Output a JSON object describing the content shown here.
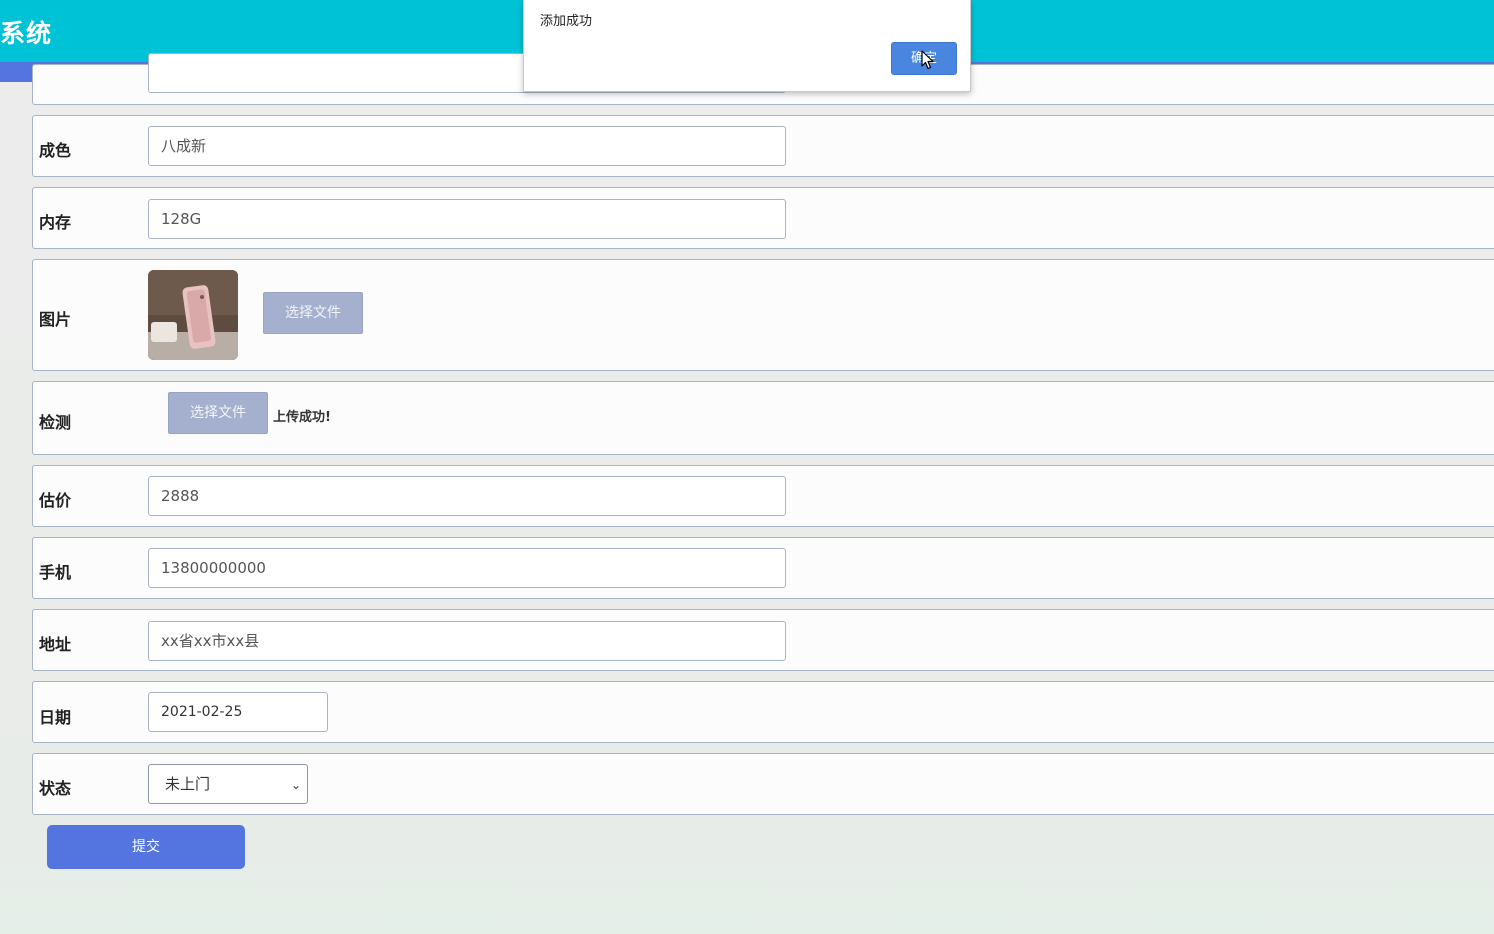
{
  "app": {
    "title": "系统"
  },
  "colors": {
    "header": "#00c2d6",
    "nav_strip": "#5475e0",
    "submit": "#5475e0",
    "file_button": "#a4b0cd",
    "dialog_button": "#4a86e0"
  },
  "form": {
    "condition": {
      "label": "成色",
      "value": "八成新"
    },
    "memory": {
      "label": "内存",
      "value": "128G"
    },
    "image": {
      "label": "图片",
      "file_button": "选择文件"
    },
    "inspection": {
      "label": "检测",
      "file_button": "选择文件",
      "upload_status": "上传成功!"
    },
    "price": {
      "label": "估价",
      "value": "2888"
    },
    "phone": {
      "label": "手机",
      "value": "13800000000"
    },
    "address": {
      "label": "地址",
      "value": "xx省xx市xx县"
    },
    "date": {
      "label": "日期",
      "value": "2021-02-25"
    },
    "status": {
      "label": "状态",
      "selected": "未上门"
    },
    "submit_label": "提交"
  },
  "dialog": {
    "message": "添加成功",
    "ok_label": "确定"
  },
  "icons": {
    "select_chevron": "chevron-down-icon",
    "cursor": "mouse-pointer-icon"
  }
}
